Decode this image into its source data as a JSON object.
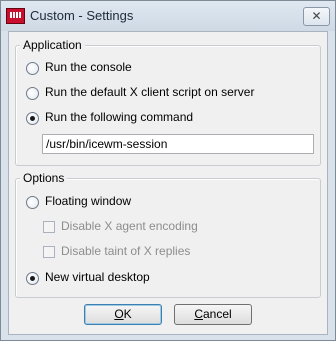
{
  "window": {
    "title": "Custom - Settings",
    "close_glyph": "✕"
  },
  "application_group": {
    "label": "Application",
    "options": [
      {
        "label": "Run the console",
        "checked": false
      },
      {
        "label": "Run the default X client script on server",
        "checked": false
      },
      {
        "label": "Run the following command",
        "checked": true
      }
    ],
    "command_value": "/usr/bin/icewm-session"
  },
  "options_group": {
    "label": "Options",
    "floating_window": {
      "label": "Floating window",
      "checked": false
    },
    "disable_x_agent_encoding": {
      "label": "Disable X agent encoding",
      "checked": false,
      "enabled": false
    },
    "disable_taint": {
      "label": "Disable taint of X replies",
      "checked": false,
      "enabled": false
    },
    "new_virtual_desktop": {
      "label": "New virtual desktop",
      "checked": true
    }
  },
  "buttons": {
    "ok": {
      "label": "OK",
      "mnemonic": "O",
      "rest": "K"
    },
    "cancel": {
      "label": "Cancel",
      "mnemonic": "C",
      "rest": "ancel"
    }
  },
  "icons": {
    "app": "app-icon",
    "close": "close-icon"
  }
}
